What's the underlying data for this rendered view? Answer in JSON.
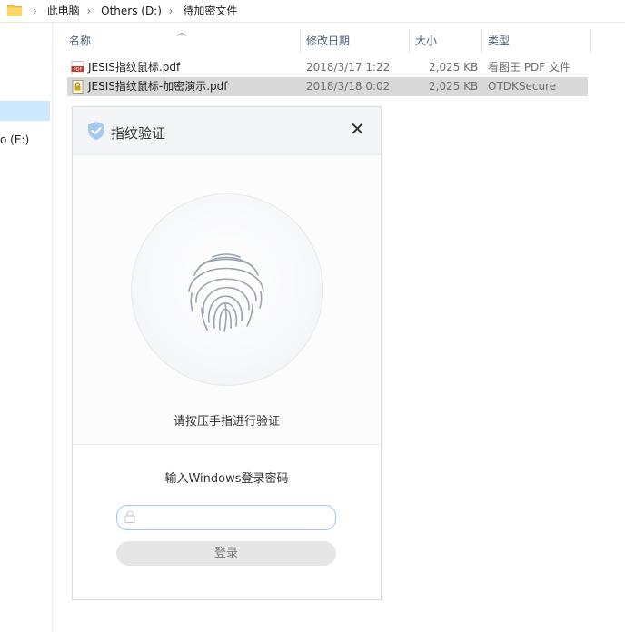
{
  "address": {
    "crumbs": [
      "此电脑",
      "Others (D:)",
      "待加密文件"
    ]
  },
  "sidebar": {
    "drive_label": "o (E:)"
  },
  "columns": {
    "name": "名称",
    "modified": "修改日期",
    "size": "大小",
    "type": "类型"
  },
  "files": [
    {
      "name": "JESIS指纹鼠标.pdf",
      "modified": "2018/3/17 1:22",
      "size": "2,025 KB",
      "type": "看图王 PDF 文件",
      "icon": "pdf-file-icon",
      "selected": false
    },
    {
      "name": "JESIS指纹鼠标-加密演示.pdf",
      "modified": "2018/3/18 0:02",
      "size": "2,025 KB",
      "type": "OTDKSecure",
      "icon": "encrypted-file-icon",
      "selected": true
    }
  ],
  "dialog": {
    "title": "指纹验证",
    "close_symbol": "✕",
    "fingerprint_prompt": "请按压手指进行验证",
    "password_label": "输入Windows登录密码",
    "password_placeholder": "",
    "login_label": "登录"
  },
  "colors": {
    "selection": "#d9d9d9",
    "accent_border": "#9cc7f5",
    "shield": "#a9c8ee"
  }
}
